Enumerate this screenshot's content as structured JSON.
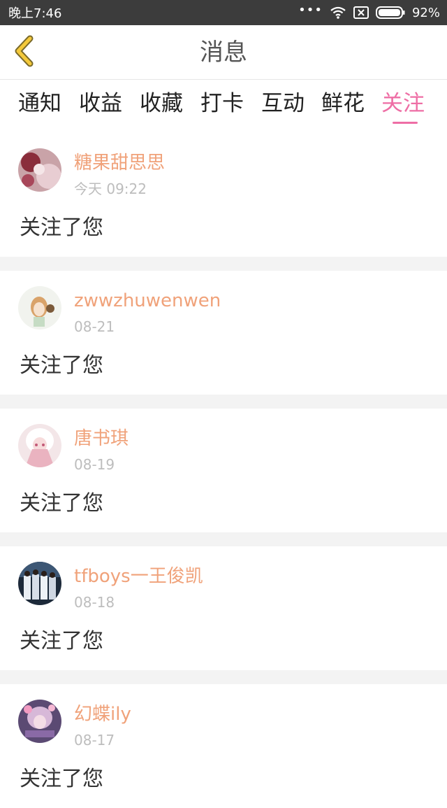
{
  "status_bar": {
    "time": "晚上7:46",
    "dots": "•••",
    "battery": "92%",
    "icons": [
      "wifi-icon",
      "sim-off-icon",
      "battery-icon"
    ]
  },
  "header": {
    "title": "消息",
    "back_icon": "chevron-left-icon"
  },
  "tabs": [
    {
      "label": "通知"
    },
    {
      "label": "收益"
    },
    {
      "label": "收藏"
    },
    {
      "label": "打卡"
    },
    {
      "label": "互动"
    },
    {
      "label": "鲜花"
    },
    {
      "label": "关注",
      "active": true
    }
  ],
  "colors": {
    "accent": "#ee6ea5",
    "username": "#f0a27a",
    "back_icon": "#f4c93b"
  },
  "messages": [
    {
      "name": "糖果甜思思",
      "time": "今天 09:22",
      "text": "关注了您"
    },
    {
      "name": "zwwzhuwenwen",
      "time": "08-21",
      "text": "关注了您"
    },
    {
      "name": "唐书琪",
      "time": "08-19",
      "text": "关注了您"
    },
    {
      "name": "tfboys一王俊凯",
      "time": "08-18",
      "text": "关注了您"
    },
    {
      "name": "幻蝶ily",
      "time": "08-17",
      "text": "关注了您"
    }
  ]
}
